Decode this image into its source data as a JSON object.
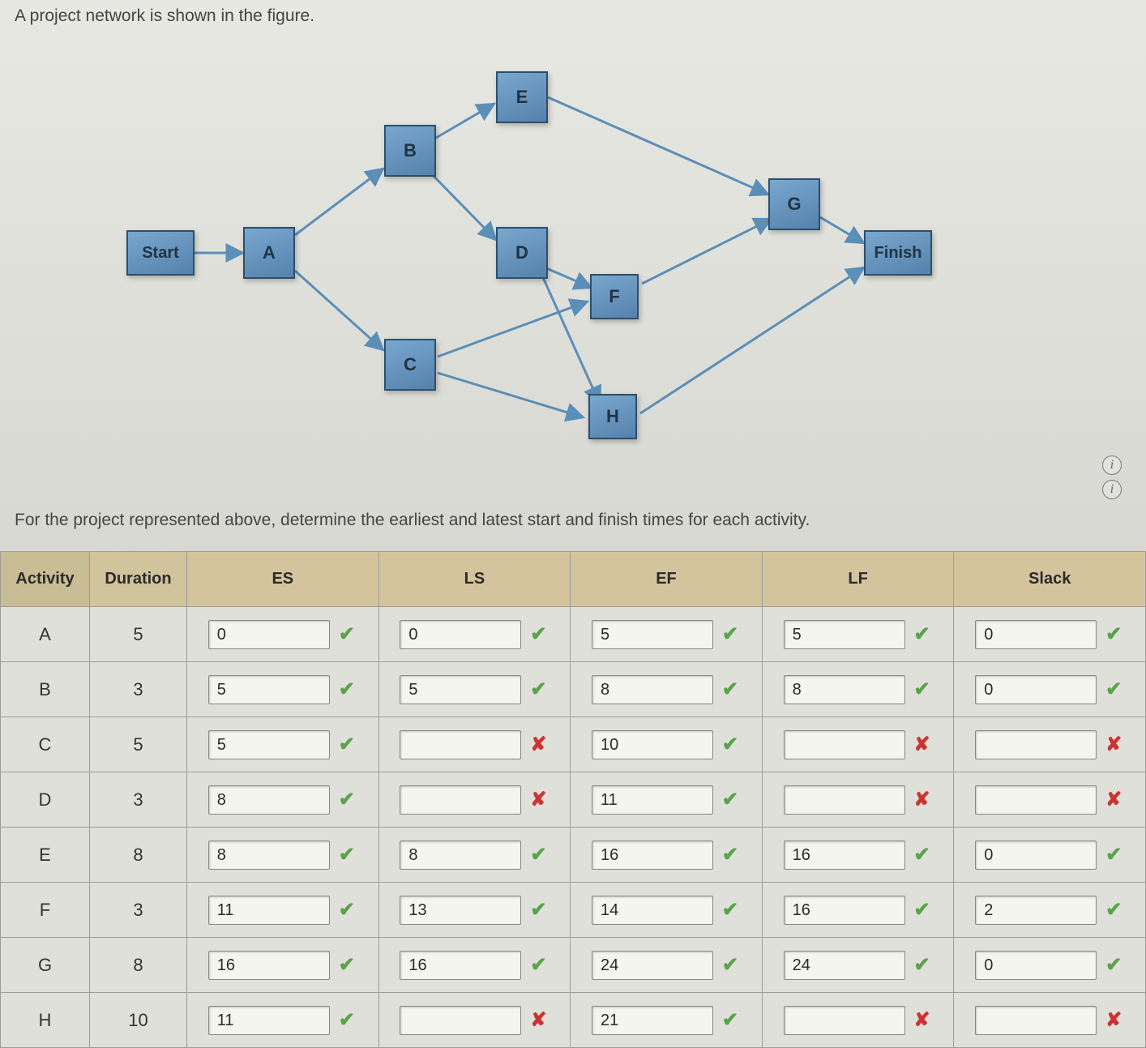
{
  "intro_text": "A project network is shown in the figure.",
  "subprompt_text": "For the project represented above, determine the earliest and latest start and finish times for each activity.",
  "nodes": {
    "Start": "Start",
    "A": "A",
    "B": "B",
    "C": "C",
    "D": "D",
    "E": "E",
    "F": "F",
    "G": "G",
    "H": "H",
    "Finish": "Finish"
  },
  "icons": {
    "check": "✔",
    "cross": "✘",
    "info": "i"
  },
  "table": {
    "headers": {
      "activity": "Activity",
      "duration": "Duration",
      "es": "ES",
      "ls": "LS",
      "ef": "EF",
      "lf": "LF",
      "slack": "Slack"
    },
    "rows": [
      {
        "activity": "A",
        "duration": "5",
        "es": {
          "val": "0",
          "mark": "ok"
        },
        "ls": {
          "val": "0",
          "mark": "ok"
        },
        "ef": {
          "val": "5",
          "mark": "ok"
        },
        "lf": {
          "val": "5",
          "mark": "ok"
        },
        "slack": {
          "val": "0",
          "mark": "ok"
        }
      },
      {
        "activity": "B",
        "duration": "3",
        "es": {
          "val": "5",
          "mark": "ok"
        },
        "ls": {
          "val": "5",
          "mark": "ok"
        },
        "ef": {
          "val": "8",
          "mark": "ok"
        },
        "lf": {
          "val": "8",
          "mark": "ok"
        },
        "slack": {
          "val": "0",
          "mark": "ok"
        }
      },
      {
        "activity": "C",
        "duration": "5",
        "es": {
          "val": "5",
          "mark": "ok"
        },
        "ls": {
          "val": "",
          "mark": "bad"
        },
        "ef": {
          "val": "10",
          "mark": "ok"
        },
        "lf": {
          "val": "",
          "mark": "bad"
        },
        "slack": {
          "val": "",
          "mark": "bad"
        }
      },
      {
        "activity": "D",
        "duration": "3",
        "es": {
          "val": "8",
          "mark": "ok"
        },
        "ls": {
          "val": "",
          "mark": "bad"
        },
        "ef": {
          "val": "11",
          "mark": "ok"
        },
        "lf": {
          "val": "",
          "mark": "bad"
        },
        "slack": {
          "val": "",
          "mark": "bad"
        }
      },
      {
        "activity": "E",
        "duration": "8",
        "es": {
          "val": "8",
          "mark": "ok"
        },
        "ls": {
          "val": "8",
          "mark": "ok"
        },
        "ef": {
          "val": "16",
          "mark": "ok"
        },
        "lf": {
          "val": "16",
          "mark": "ok"
        },
        "slack": {
          "val": "0",
          "mark": "ok"
        }
      },
      {
        "activity": "F",
        "duration": "3",
        "es": {
          "val": "11",
          "mark": "ok"
        },
        "ls": {
          "val": "13",
          "mark": "ok"
        },
        "ef": {
          "val": "14",
          "mark": "ok"
        },
        "lf": {
          "val": "16",
          "mark": "ok"
        },
        "slack": {
          "val": "2",
          "mark": "ok"
        }
      },
      {
        "activity": "G",
        "duration": "8",
        "es": {
          "val": "16",
          "mark": "ok"
        },
        "ls": {
          "val": "16",
          "mark": "ok"
        },
        "ef": {
          "val": "24",
          "mark": "ok"
        },
        "lf": {
          "val": "24",
          "mark": "ok"
        },
        "slack": {
          "val": "0",
          "mark": "ok"
        }
      },
      {
        "activity": "H",
        "duration": "10",
        "es": {
          "val": "11",
          "mark": "ok"
        },
        "ls": {
          "val": "",
          "mark": "bad"
        },
        "ef": {
          "val": "21",
          "mark": "ok"
        },
        "lf": {
          "val": "",
          "mark": "bad"
        },
        "slack": {
          "val": "",
          "mark": "bad"
        }
      }
    ]
  }
}
